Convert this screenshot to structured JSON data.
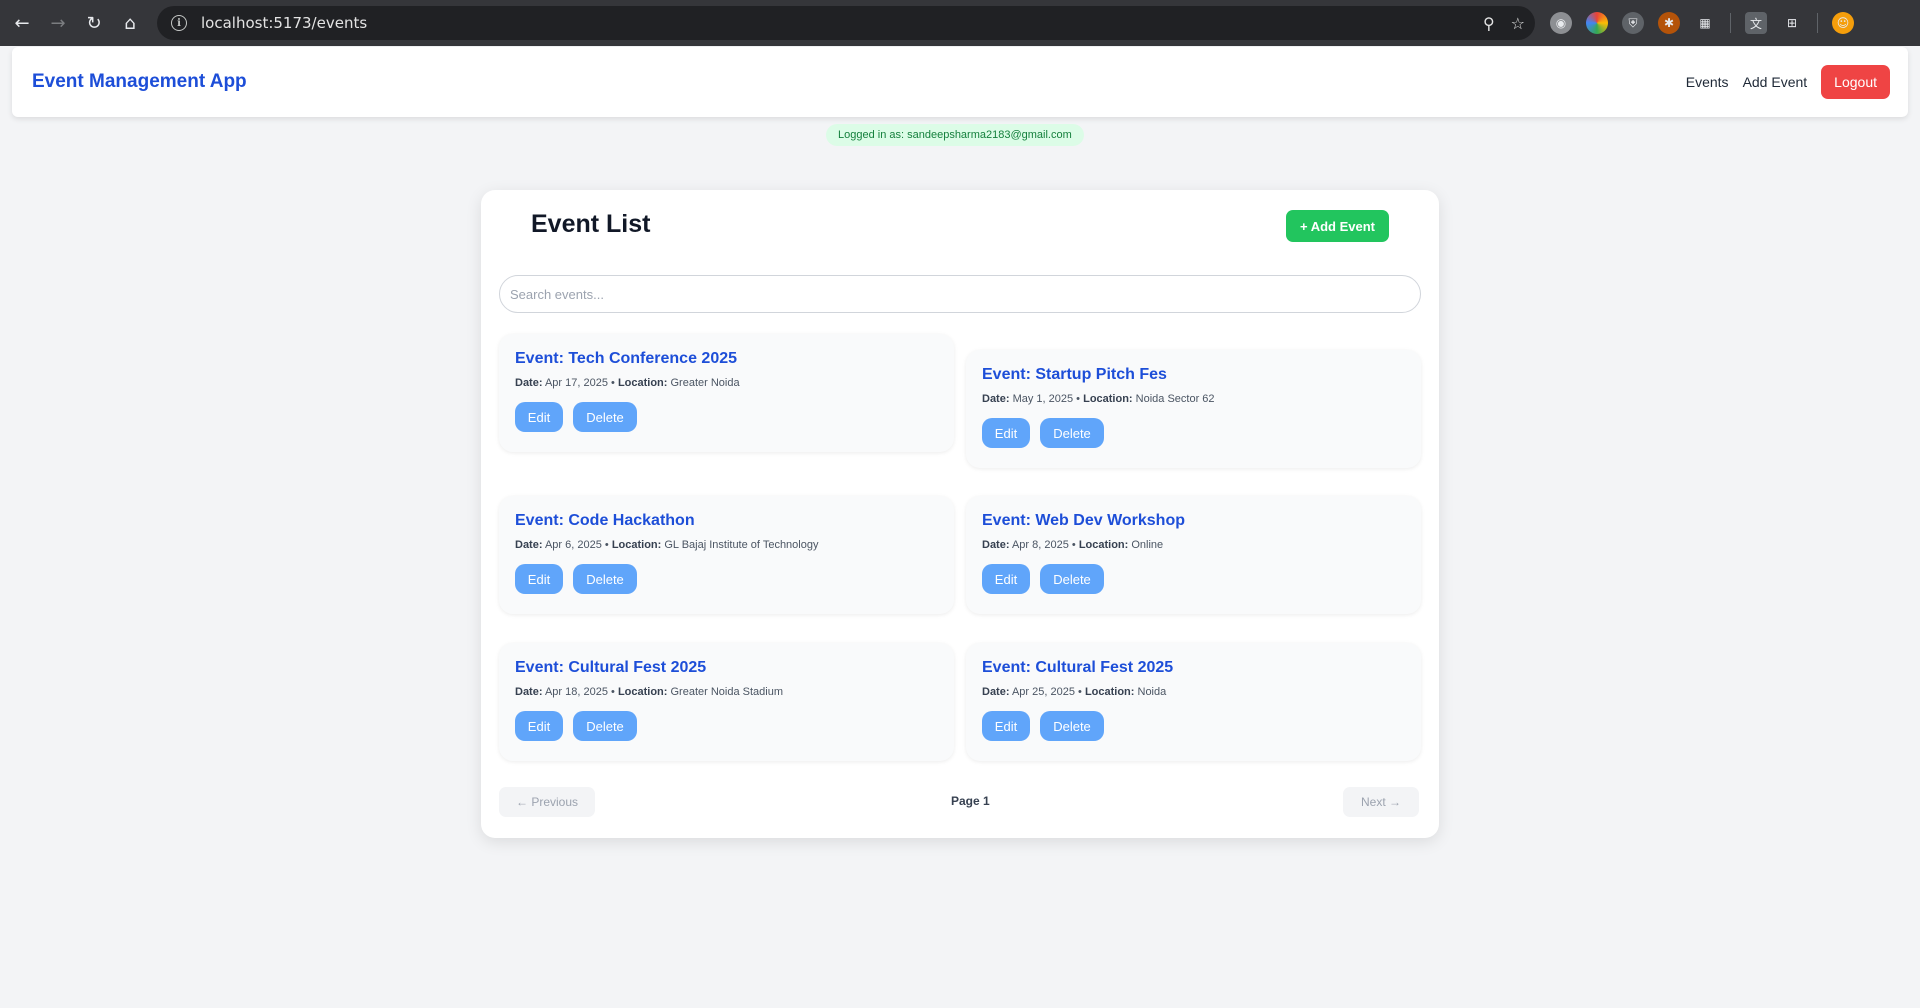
{
  "browser": {
    "url": "localhost:5173/events"
  },
  "navbar": {
    "brand": "Event Management App",
    "links": [
      "Events",
      "Add Event"
    ],
    "logout_label": "Logout"
  },
  "login_status": "Logged in as: sandeepsharma2183@gmail.com",
  "main": {
    "title": "Event List",
    "add_button": "+ Add Event",
    "search_placeholder": "Search events...",
    "date_label": "Date:",
    "location_label": "Location:",
    "edit_label": "Edit",
    "delete_label": "Delete",
    "events": [
      {
        "title": "Event: Tech Conference 2025",
        "date": "Apr 17, 2025",
        "location": "Greater Noida"
      },
      {
        "title": "Event: Startup Pitch Fes",
        "date": "May 1, 2025",
        "location": "Noida Sector 62"
      },
      {
        "title": "Event: Code Hackathon",
        "date": "Apr 6, 2025",
        "location": "GL Bajaj Institute of Technology"
      },
      {
        "title": "Event: Web Dev Workshop",
        "date": "Apr 8, 2025",
        "location": "Online"
      },
      {
        "title": "Event: Cultural Fest 2025",
        "date": "Apr 18, 2025",
        "location": "Greater Noida Stadium"
      },
      {
        "title": "Event: Cultural Fest 2025",
        "date": "Apr 25, 2025",
        "location": "Noida"
      }
    ],
    "pagination": {
      "prev_label": "← Previous",
      "page_label": "Page 1",
      "next_label": "Next →"
    }
  }
}
